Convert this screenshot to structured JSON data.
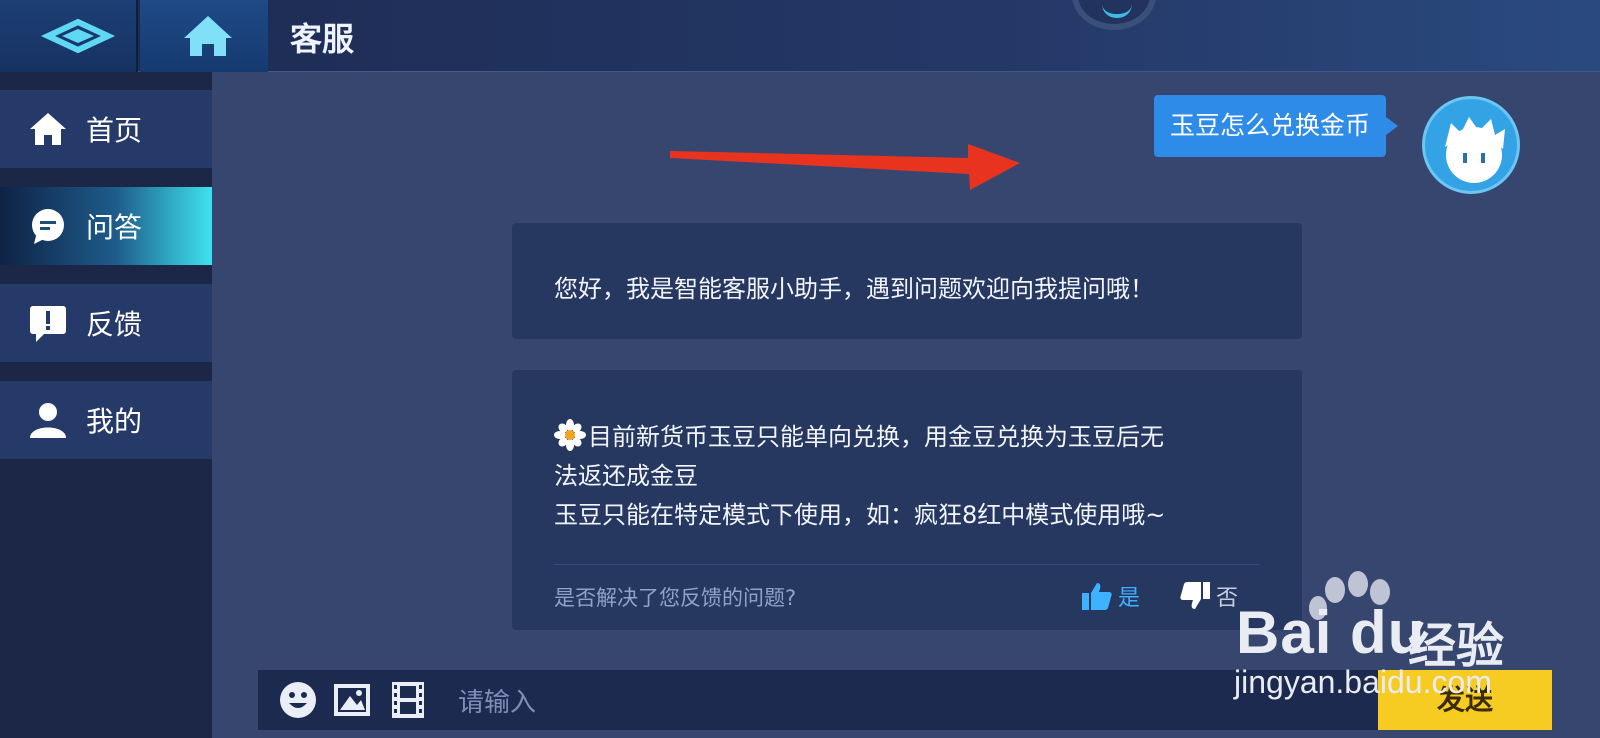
{
  "header": {
    "title": "客服",
    "back_icon": "back-icon",
    "home_icon": "home-icon"
  },
  "sidebar": {
    "items": [
      {
        "label": "首页",
        "icon": "home-icon"
      },
      {
        "label": "问答",
        "icon": "chat-bubble-icon",
        "active": true
      },
      {
        "label": "反馈",
        "icon": "feedback-icon"
      },
      {
        "label": "我的",
        "icon": "user-icon"
      }
    ]
  },
  "chat": {
    "user_message": "玉豆怎么兑换金币",
    "bot_greeting": "您好，我是智能客服小助手，遇到问题欢迎向我提问哦！",
    "bot_answer_lines": [
      "目前新货币玉豆只能单向兑换，用金豆兑换为玉豆后无",
      "法返还成金豆",
      "玉豆只能在特定模式下使用，如：疯狂8红中模式使用哦~"
    ],
    "resolved_question": "是否解决了您反馈的问题?",
    "yes_label": "是",
    "no_label": "否"
  },
  "input": {
    "placeholder": "请输入",
    "send_label": "发送"
  },
  "watermark": {
    "brand": "Bai du",
    "brand_suffix": "经验",
    "url": "jingyan.baidu.com"
  },
  "colors": {
    "accent": "#2f8be8",
    "send": "#f7cc22",
    "active_tab": "#3ee3f0",
    "arrow": "#e8331f"
  }
}
